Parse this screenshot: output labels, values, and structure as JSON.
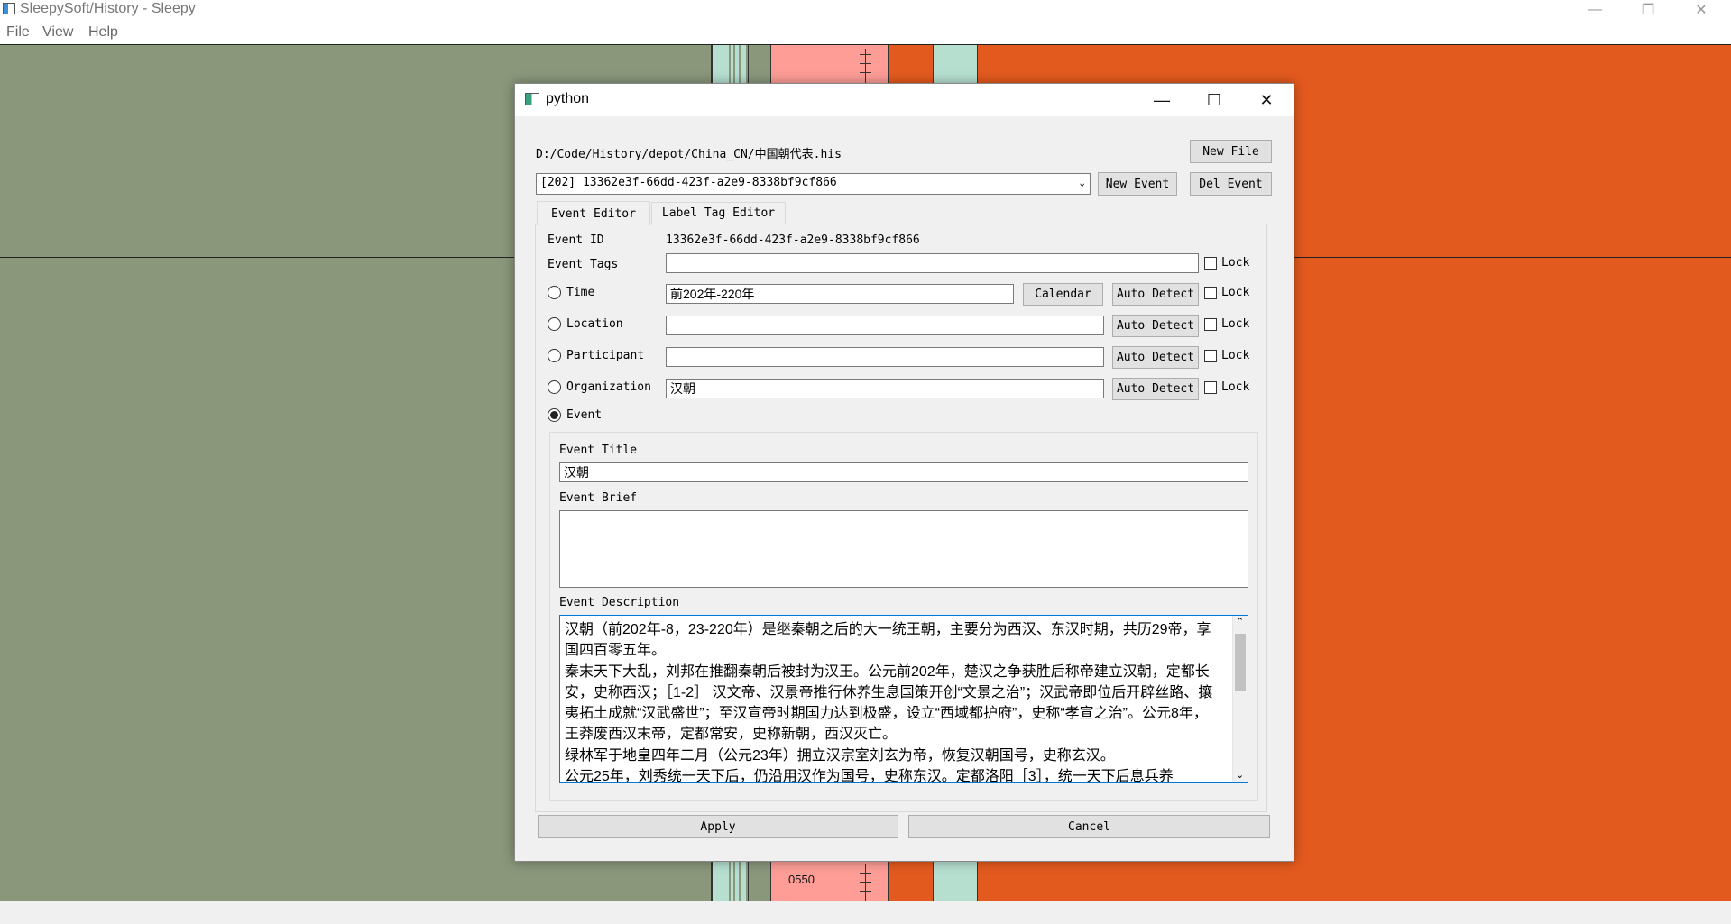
{
  "window": {
    "title": "SleepySoft/History - Sleepy",
    "menu": [
      "File",
      "View",
      "Help"
    ]
  },
  "timeline": {
    "tick_label": "0550"
  },
  "dialog": {
    "title": "python",
    "file_path": "D:/Code/History/depot/China_CN/中国朝代表.his",
    "new_file_label": "New File",
    "event_selector_value": "[202] 13362e3f-66dd-423f-a2e9-8338bf9cf866",
    "new_event_label": "New Event",
    "del_event_label": "Del Event",
    "tabs": [
      {
        "label": "Event Editor",
        "active": true
      },
      {
        "label": "Label Tag Editor",
        "active": false
      }
    ],
    "event_id_label": "Event ID",
    "event_id_value": "13362e3f-66dd-423f-a2e9-8338bf9cf866",
    "event_tags_label": "Event Tags",
    "event_tags_value": "",
    "time_label": "Time",
    "time_value": "前202年-220年",
    "calendar_label": "Calendar",
    "auto_detect_label": "Auto Detect",
    "lock_label": "Lock",
    "location_label": "Location",
    "location_value": "",
    "participant_label": "Participant",
    "participant_value": "",
    "organization_label": "Organization",
    "organization_value": "汉朝",
    "event_radio_label": "Event",
    "event_title_label": "Event Title",
    "event_title_value": "汉朝",
    "event_brief_label": "Event Brief",
    "event_brief_value": "",
    "event_description_label": "Event Description",
    "event_description_value": "汉朝（前202年-8，23-220年）是继秦朝之后的大一统王朝，主要分为西汉、东汉时期，共历29帝，享国四百零五年。\n秦末天下大乱，刘邦在推翻秦朝后被封为汉王。公元前202年，楚汉之争获胜后称帝建立汉朝，定都长安，史称西汉；［1-2］ 汉文帝、汉景帝推行休养生息国策开创“文景之治”；汉武帝即位后开辟丝路、攘夷拓土成就“汉武盛世”；至汉宣帝时期国力达到极盛，设立“西域都护府”，史称“孝宣之治”。公元8年，王莽废西汉末帝，定都常安，史称新朝，西汉灭亡。\n绿林军于地皇四年二月（公元23年）拥立汉宗室刘玄为帝，恢复汉朝国号，史称玄汉。\n公元25年，刘秀统一天下后，仍沿用汉作为国号，史称东汉。定都洛阳［3］，统一天下后息兵养",
    "apply_label": "Apply",
    "cancel_label": "Cancel"
  },
  "colors": {
    "canvas_green": "#8a977b",
    "orange": "#e35a1e",
    "pink": "#fd9d96",
    "teal": "#b6dfd0",
    "focus_blue": "#0078d7"
  }
}
